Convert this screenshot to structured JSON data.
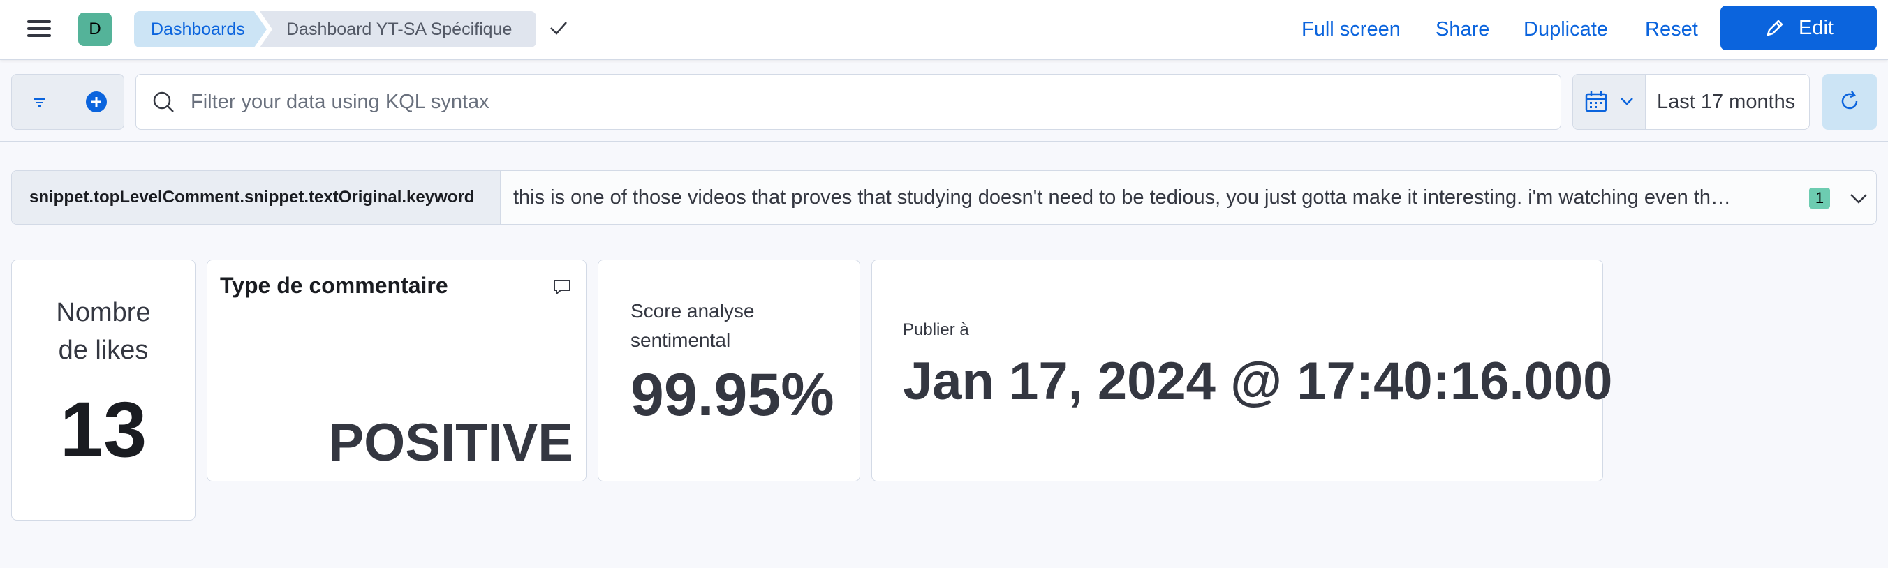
{
  "header": {
    "space_initial": "D",
    "breadcrumbs": [
      "Dashboards",
      "Dashboard YT-SA Spécifique"
    ],
    "actions": {
      "full_screen": "Full screen",
      "share": "Share",
      "duplicate": "Duplicate",
      "reset": "Reset",
      "edit": "Edit"
    }
  },
  "query_bar": {
    "search_placeholder": "Filter your data using KQL syntax",
    "search_value": "",
    "date_range": "Last 17 months",
    "icons": [
      "filter-icon",
      "add-filter-icon",
      "search-icon",
      "calendar-icon",
      "chevron-down-icon",
      "refresh-icon"
    ]
  },
  "control": {
    "label": "snippet.topLevelComment.snippet.textOriginal.keyword",
    "value": "this is one of those videos that proves that studying doesn't need to be tedious, you just gotta make it interesting. i'm watching even th…",
    "selection_count": "1"
  },
  "panels": {
    "likes": {
      "label_line1": "Nombre",
      "label_line2": "de likes",
      "value": "13"
    },
    "comment_type": {
      "title": "Type de commentaire",
      "value": "POSITIVE"
    },
    "sentiment": {
      "label_line1": "Score analyse",
      "label_line2": "sentimental",
      "value": "99.95%"
    },
    "published": {
      "label": "Publier à",
      "value": "Jan 17, 2024 @ 17:40:16.000"
    }
  },
  "colors": {
    "primary": "#0b64dd",
    "avatar": "#54b399",
    "badge": "#6dccb1",
    "breadcrumb_active": "#cce4f5"
  }
}
